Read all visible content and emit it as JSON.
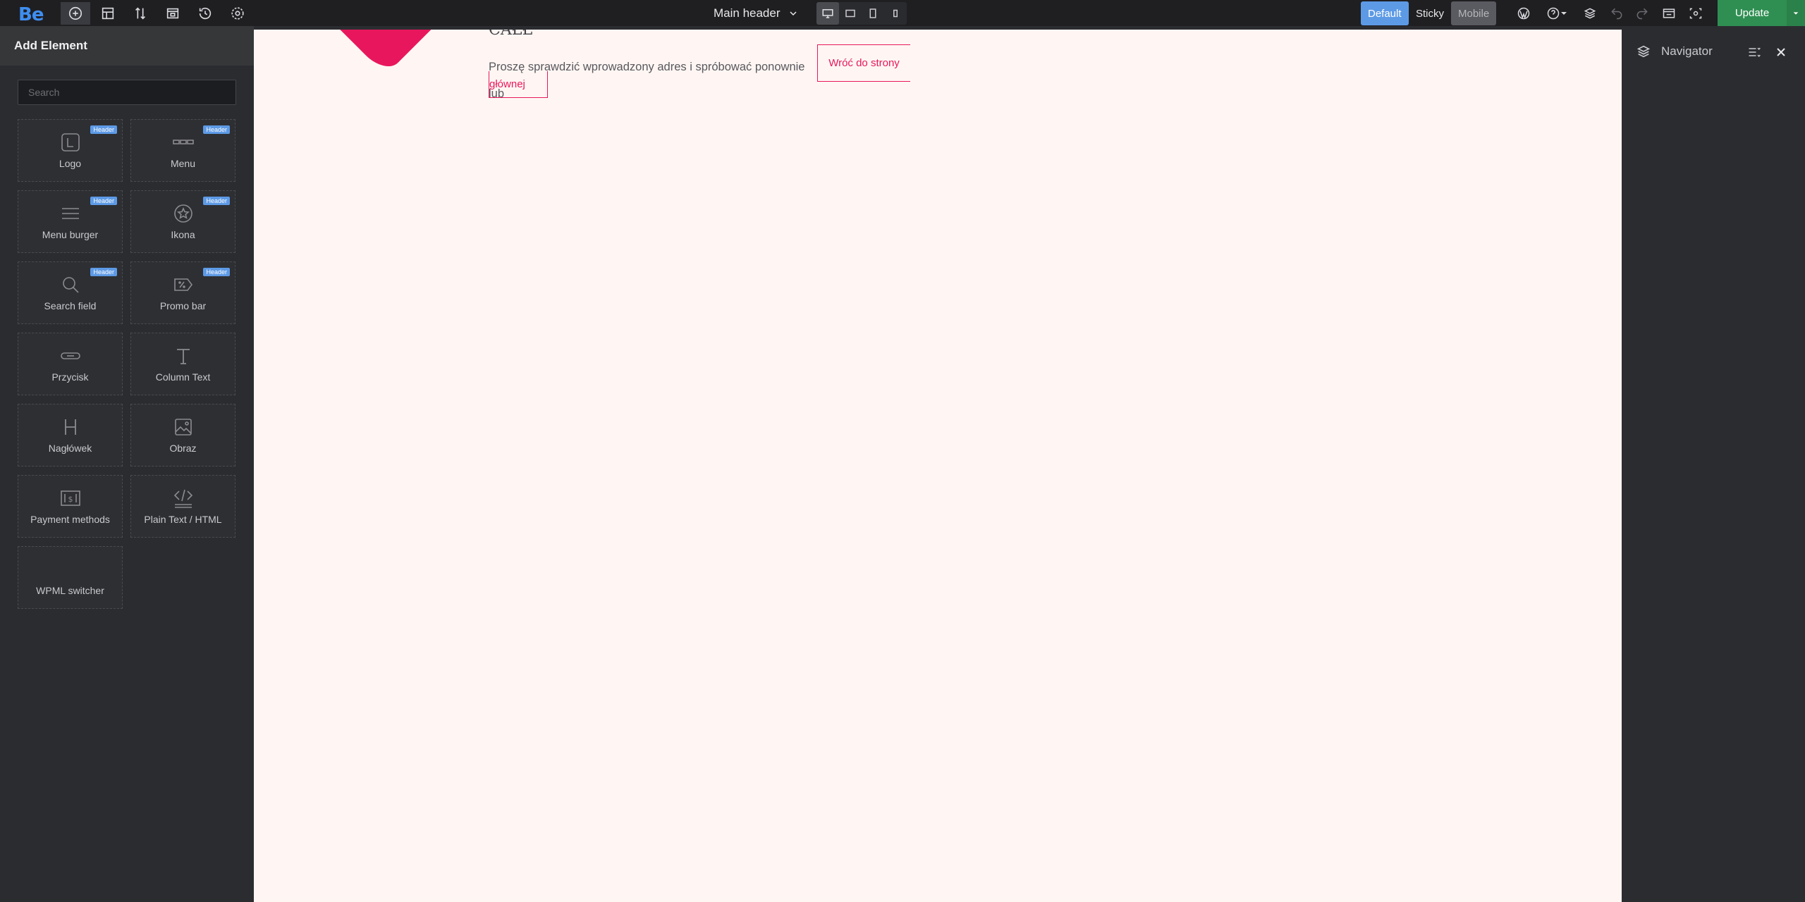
{
  "topbar": {
    "logo": "Be",
    "header_select": "Main header",
    "states": {
      "default": "Default",
      "sticky": "Sticky",
      "mobile": "Mobile"
    },
    "update_label": "Update"
  },
  "left_panel": {
    "title": "Add Element",
    "search_placeholder": "Search",
    "elements": [
      {
        "label": "Logo",
        "badge": "Header",
        "icon": "logo-icon"
      },
      {
        "label": "Menu",
        "badge": "Header",
        "icon": "menu-icon"
      },
      {
        "label": "Menu burger",
        "badge": "Header",
        "icon": "menu-burger-icon"
      },
      {
        "label": "Ikona",
        "badge": "Header",
        "icon": "star-circle-icon"
      },
      {
        "label": "Search field",
        "badge": "Header",
        "icon": "search-icon"
      },
      {
        "label": "Promo bar",
        "badge": "Header",
        "icon": "promo-tag-icon"
      },
      {
        "label": "Przycisk",
        "icon": "button-icon"
      },
      {
        "label": "Column Text",
        "icon": "text-icon"
      },
      {
        "label": "Nagłówek",
        "icon": "heading-icon"
      },
      {
        "label": "Obraz",
        "icon": "image-icon"
      },
      {
        "label": "Payment methods",
        "icon": "payment-icon"
      },
      {
        "label": "Plain Text / HTML",
        "icon": "code-icon"
      },
      {
        "label": "WPML switcher",
        "icon": ""
      }
    ]
  },
  "canvas": {
    "error_title": "CAŁŁ",
    "error_text": "Proszę sprawdzić wprowadzony adres i spróbować ponownie lub",
    "back_button_1": "Wróć do strony",
    "back_button_2": "głównej"
  },
  "right_panel": {
    "title": "Navigator"
  },
  "colors": {
    "accent_blue": "#5d9ae6",
    "update_green": "#2f8f52",
    "brand_pink": "#e8175d",
    "canvas_bg": "#fff6f3"
  }
}
